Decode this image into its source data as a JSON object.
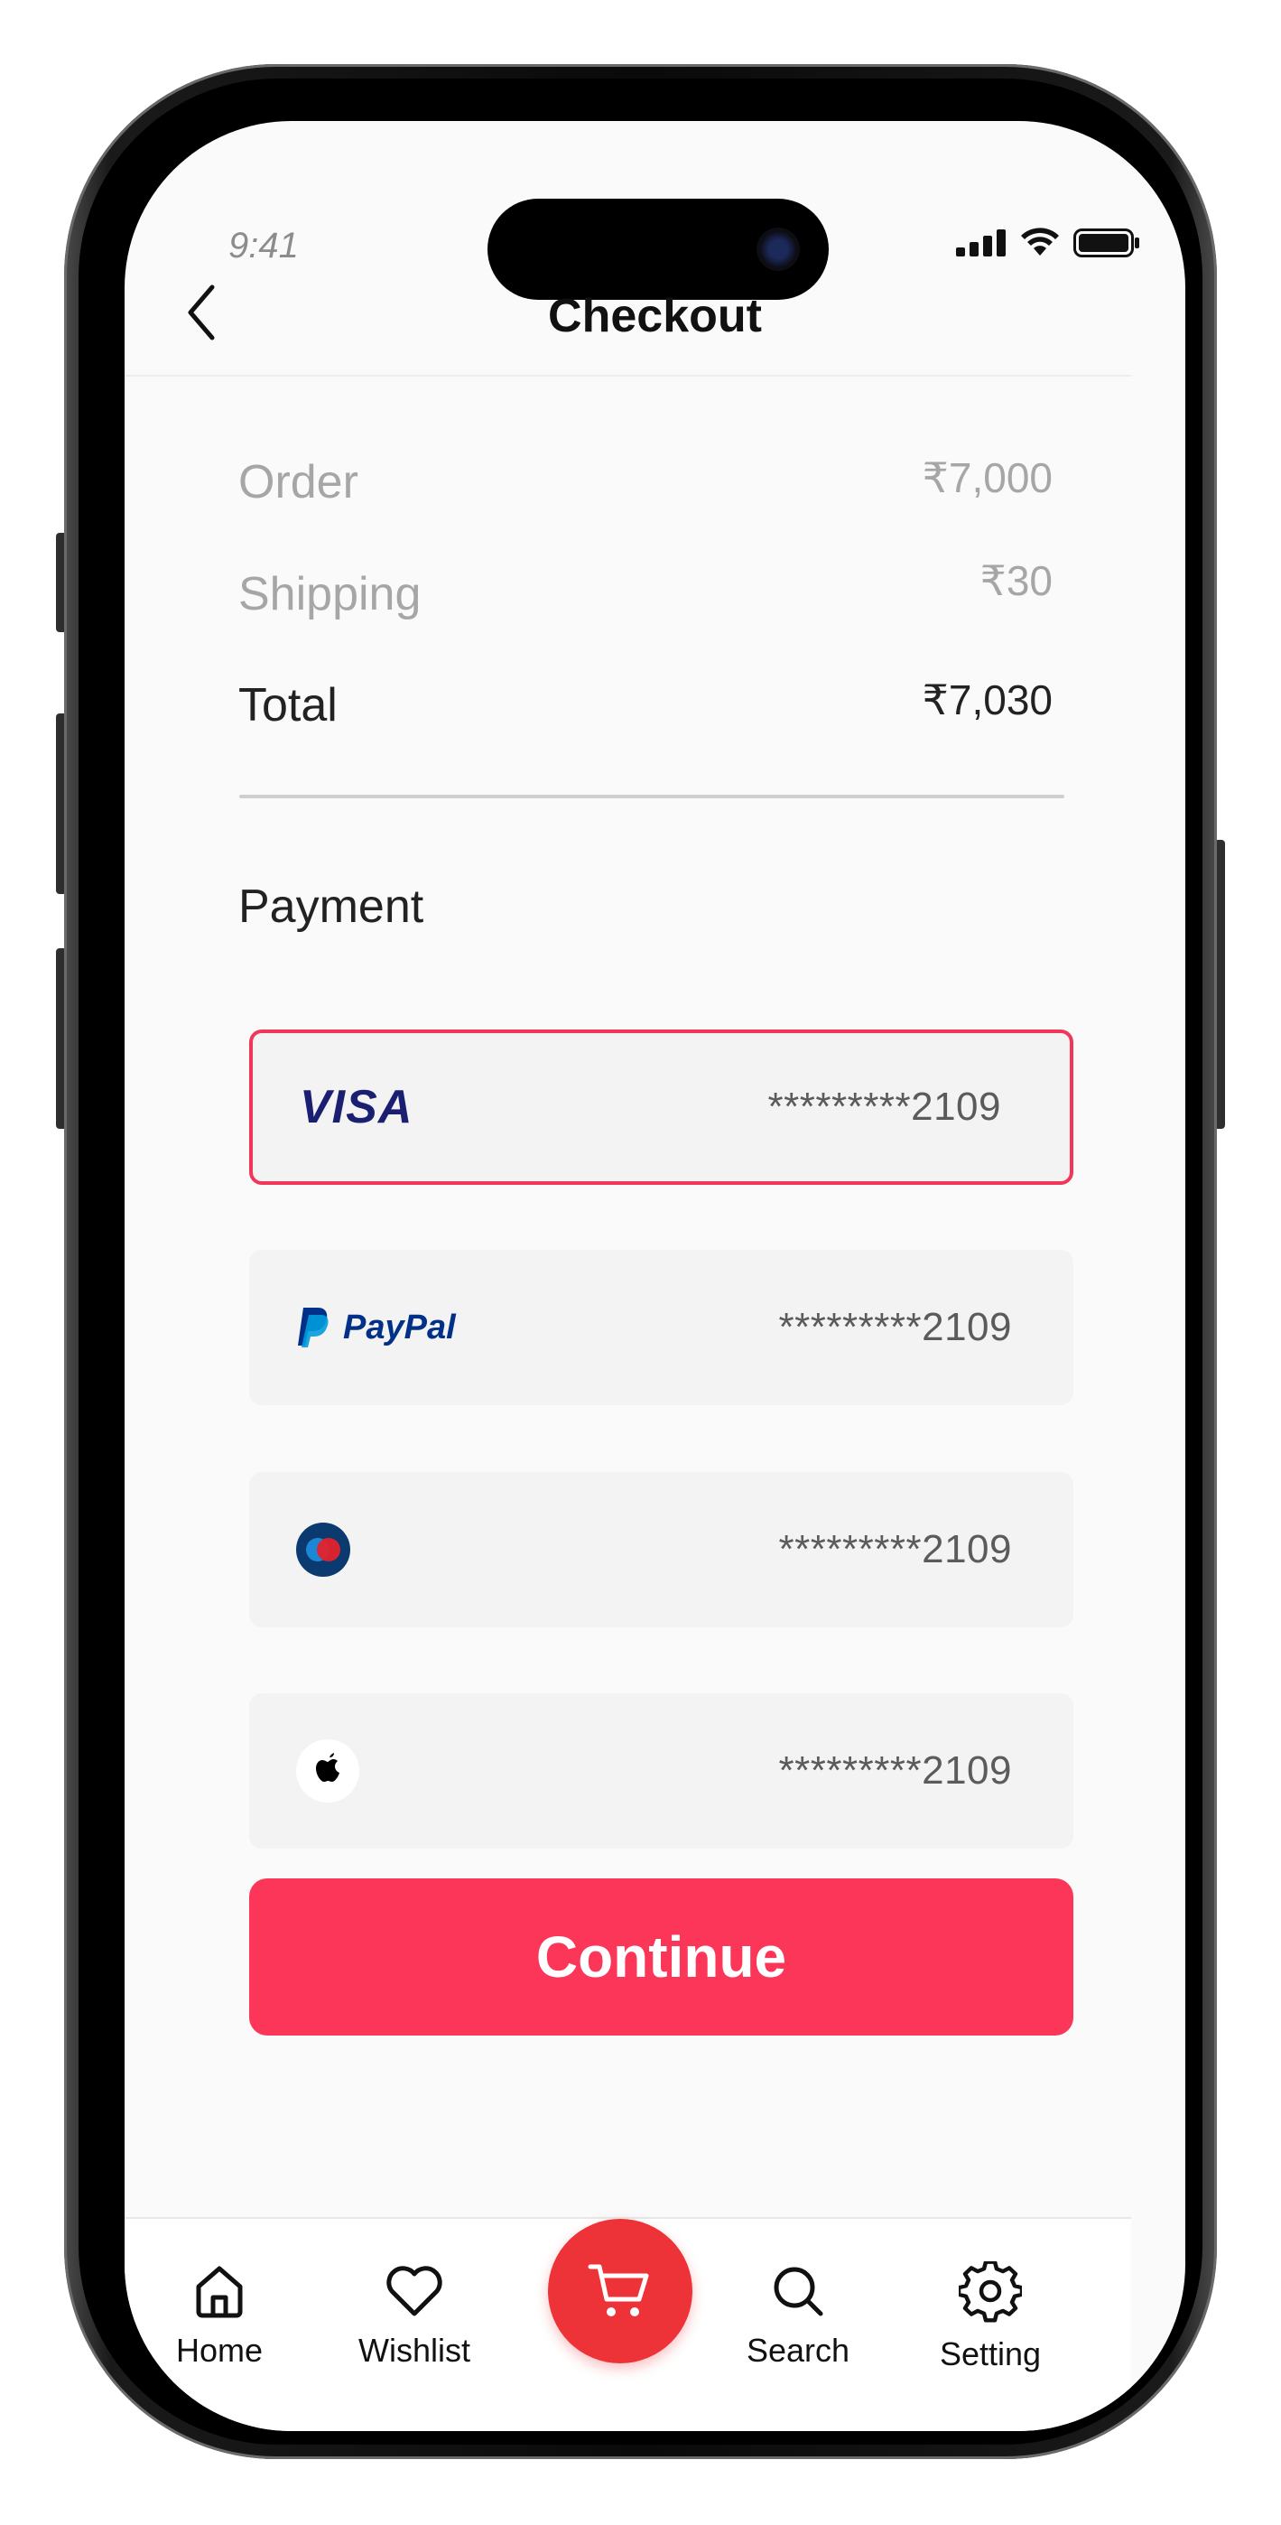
{
  "status_bar": {
    "time": "9:41"
  },
  "header": {
    "title": "Checkout"
  },
  "summary": {
    "order_label": "Order",
    "order_value": "₹7,000",
    "shipping_label": "Shipping",
    "shipping_value": "₹30",
    "total_label": "Total",
    "total_value": "₹7,030"
  },
  "payment": {
    "title": "Payment",
    "methods": [
      {
        "brand_text": "VISA",
        "number": "*********2109",
        "selected": true
      },
      {
        "brand_text": "PayPal",
        "number": "*********2109",
        "selected": false
      },
      {
        "brand_text": "Maestro",
        "number": "*********2109",
        "selected": false
      },
      {
        "brand_text": "Apple Pay",
        "number": "*********2109",
        "selected": false
      }
    ]
  },
  "continue_label": "Continue",
  "tabbar": {
    "items": [
      {
        "label": "Home",
        "icon": "home-icon"
      },
      {
        "label": "Wishlist",
        "icon": "heart-icon"
      },
      {
        "label": "",
        "icon": "cart-icon"
      },
      {
        "label": "Search",
        "icon": "search-icon"
      },
      {
        "label": "Setting",
        "icon": "gear-icon"
      }
    ]
  },
  "colors": {
    "accent": "#fb3658",
    "cart_fab": "#ee3338",
    "selected_border": "#f0375a",
    "card_bg": "#f3f3f3"
  }
}
